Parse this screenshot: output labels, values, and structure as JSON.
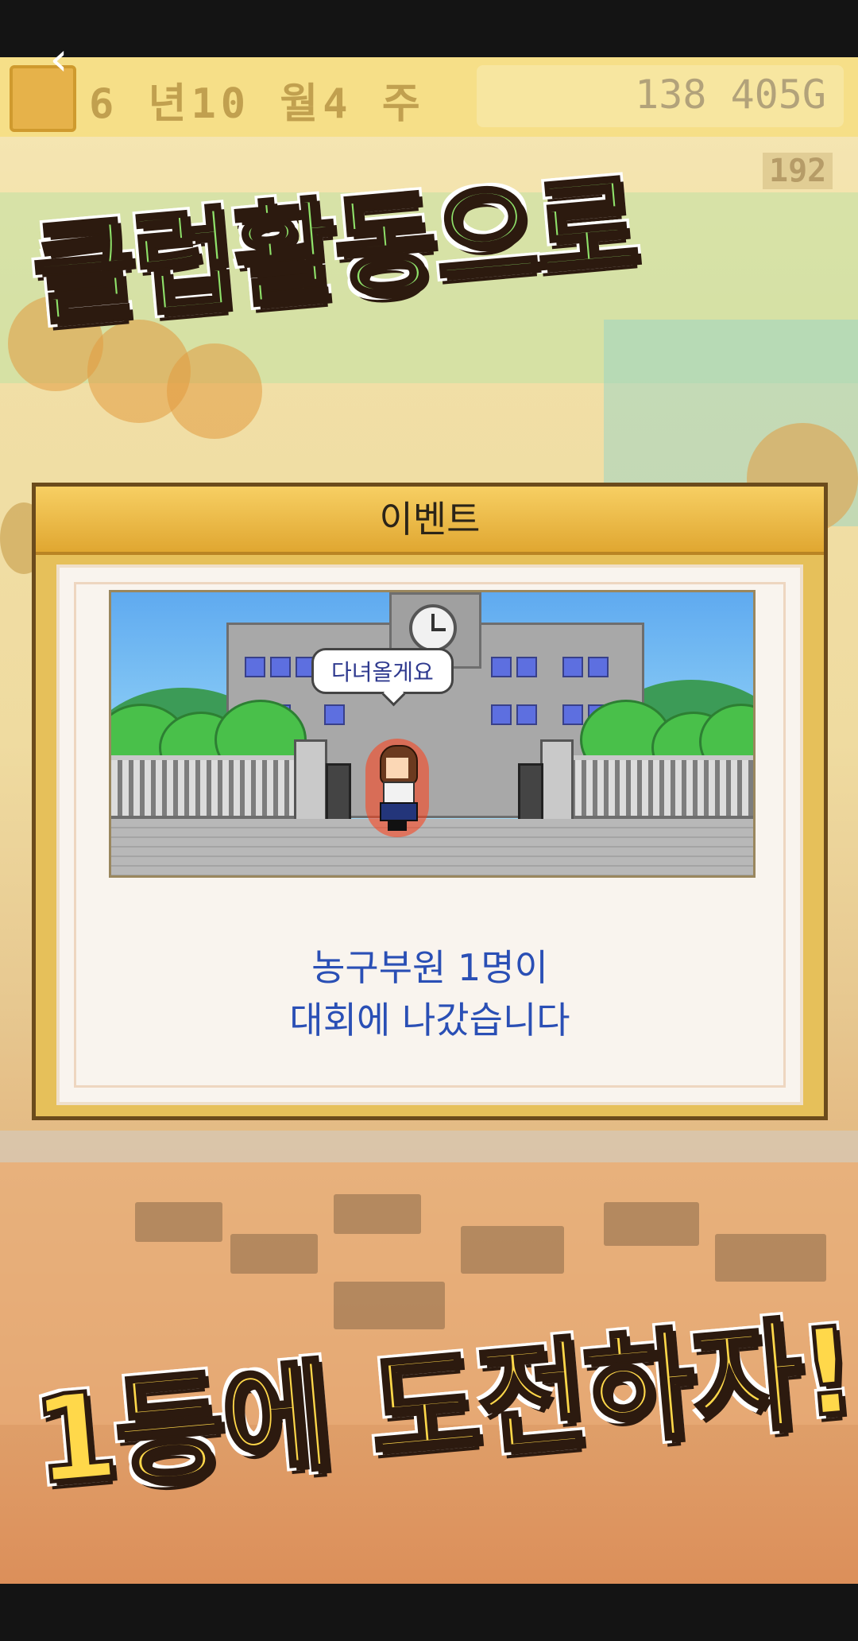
{
  "system": {
    "back_icon": "chevron-left-icon"
  },
  "hud": {
    "date": "6 년10 월4 주",
    "money": "138 405G",
    "small_counter": "192"
  },
  "promo": {
    "headline_top": "클럽활동으로",
    "headline_bottom": "1등에 도전하자!"
  },
  "dialog": {
    "title": "이벤트",
    "speech_bubble": "다녀올게요",
    "message_line1": "농구부원 1명이",
    "message_line2": "대회에 나갔습니다"
  },
  "colors": {
    "headline_top": "#8fe26a",
    "headline_bottom": "#ffd84a",
    "message_text": "#2a4fb5",
    "title_bar": "#f0c04a"
  }
}
